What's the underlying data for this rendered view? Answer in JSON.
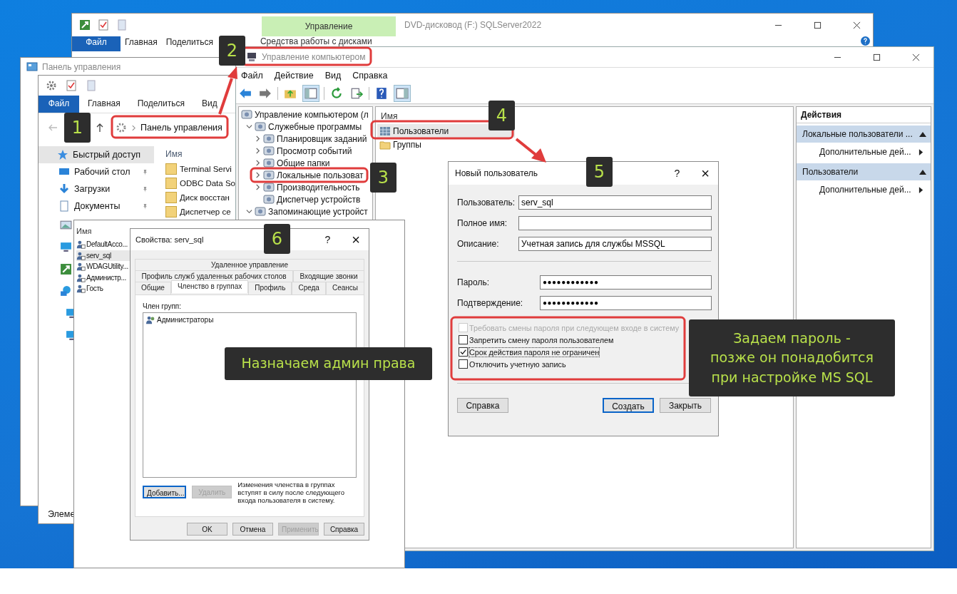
{
  "drive_window": {
    "title": "DVD-дисковод (F:) SQLServer2022",
    "context_group": "Управление",
    "context_tab": "Средства работы с дисками",
    "tabs": [
      {
        "label": "Файл",
        "selected": true
      },
      {
        "label": "Главная",
        "selected": false
      },
      {
        "label": "Поделиться",
        "selected": false
      }
    ]
  },
  "control_panel": {
    "title": "Панель управления",
    "address": "Панель управления",
    "column": "Имя",
    "status": "Элеме",
    "tabs": [
      {
        "label": "Файл",
        "selected": true
      },
      {
        "label": "Главная",
        "selected": false
      },
      {
        "label": "Поделиться",
        "selected": false
      },
      {
        "label": "Вид",
        "selected": false
      }
    ],
    "nav": [
      {
        "label": "Быстрый доступ",
        "selected": true,
        "pinned": false
      },
      {
        "label": "Рабочий стол",
        "selected": false,
        "pinned": true
      },
      {
        "label": "Загрузки",
        "selected": false,
        "pinned": true
      },
      {
        "label": "Документы",
        "selected": false,
        "pinned": true
      }
    ],
    "files": [
      "Terminal Servi",
      "ODBC Data So",
      "Диск восстан",
      "Диспетчер се"
    ]
  },
  "comp_mgmt": {
    "title": "Управление компьютером",
    "menu": [
      "Файл",
      "Действие",
      "Вид",
      "Справка"
    ],
    "tree": [
      {
        "label": "Управление компьютером (л",
        "children": [
          {
            "label": "Служебные программы",
            "expanded": true,
            "children": [
              {
                "label": "Планировщик заданий",
                "expanded": false
              },
              {
                "label": "Просмотр событий",
                "expanded": false
              },
              {
                "label": "Общие папки",
                "expanded": false
              },
              {
                "label": "Локальные пользоват",
                "expanded": false
              },
              {
                "label": "Производительность",
                "expanded": false
              },
              {
                "label": "Диспетчер устройств"
              }
            ]
          },
          {
            "label": "Запоминающие устройст",
            "expanded": true
          }
        ]
      }
    ],
    "column": "Имя",
    "items": [
      {
        "label": "Пользователи",
        "selected": true,
        "kind": "users"
      },
      {
        "label": "Группы",
        "selected": false,
        "kind": "folder"
      }
    ],
    "actions_title": "Действия",
    "actions": [
      {
        "title": "Локальные пользователи ...",
        "items": [
          "Дополнительные дей..."
        ]
      },
      {
        "title": "Пользователи",
        "items": [
          "Дополнительные дей..."
        ]
      }
    ]
  },
  "users_list": {
    "column": "Имя",
    "rows": [
      {
        "name": "DefaultAcco...",
        "selected": false
      },
      {
        "name": "serv_sql",
        "selected": true
      },
      {
        "name": "WDAGUtility...",
        "selected": false
      },
      {
        "name": "Администр...",
        "selected": false
      },
      {
        "name": "Гость",
        "selected": false
      }
    ]
  },
  "properties": {
    "title": "Свойства: serv_sql",
    "help": "?",
    "close": "×",
    "tab_rows": [
      [
        {
          "label": "Удаленное управление",
          "selected": false
        }
      ],
      [
        {
          "label": "Профиль служб удаленных рабочих столов",
          "selected": false
        },
        {
          "label": "Входящие звонки",
          "selected": false
        }
      ],
      [
        {
          "label": "Общие",
          "selected": false
        },
        {
          "label": "Членство в группах",
          "selected": true
        },
        {
          "label": "Профиль",
          "selected": false
        },
        {
          "label": "Среда",
          "selected": false
        },
        {
          "label": "Сеансы",
          "selected": false
        }
      ]
    ],
    "member_label": "Член групп:",
    "members": [
      "Администраторы"
    ],
    "buttons": [
      {
        "label": "Добавить...",
        "disabled": false
      },
      {
        "label": "Удалить",
        "disabled": true
      }
    ],
    "note": "Изменения членства в группах вступят в силу после следующего входа пользователя в систему.",
    "footer": [
      {
        "label": "OK",
        "disabled": false
      },
      {
        "label": "Отмена",
        "disabled": false
      },
      {
        "label": "Применить",
        "disabled": true
      },
      {
        "label": "Справка",
        "disabled": false
      }
    ]
  },
  "new_user": {
    "title": "Новый пользователь",
    "help": "?",
    "close": "×",
    "fields": [
      {
        "label": "Пользователь:",
        "value": "serv_sql"
      },
      {
        "label": "Полное имя:"
      },
      {
        "label": "Описание:",
        "value": "Учетная запись для службы MSSQL"
      }
    ],
    "passwords": [
      {
        "label": "Пароль:",
        "value": "●●●●●●●●●●●●"
      },
      {
        "label": "Подтверждение:",
        "value": "●●●●●●●●●●●●"
      }
    ],
    "options": [
      {
        "label": "Требовать смены пароля при следующем входе в систему",
        "checked": false,
        "disabled": true
      },
      {
        "label": "Запретить смену пароля пользователем",
        "checked": false,
        "disabled": false
      },
      {
        "label": "Срок действия пароля не ограничен",
        "checked": true,
        "disabled": false
      },
      {
        "label": "Отключить учетную запись",
        "checked": false,
        "disabled": false
      }
    ],
    "buttons": [
      {
        "label": "Справка",
        "default": false
      },
      {
        "label": "Создать",
        "default": true
      },
      {
        "label": "Закрыть",
        "default": false
      }
    ]
  },
  "badges": [
    "1",
    "2",
    "3",
    "4",
    "5",
    "6"
  ],
  "callouts": [
    {
      "lines": [
        "Назначаем админ права"
      ]
    },
    {
      "lines": [
        "Задаем пароль -",
        "позже он понадобится",
        "при настройке MS SQL"
      ]
    }
  ]
}
